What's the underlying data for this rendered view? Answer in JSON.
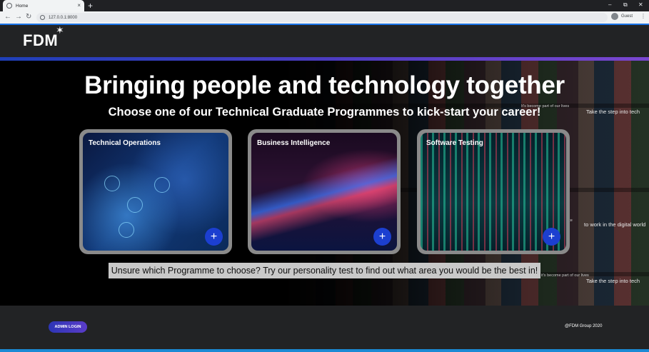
{
  "browser": {
    "tab_title": "Home",
    "tab_close": "×",
    "new_tab": "+",
    "url": "127.0.0.1:8000",
    "profile_label": "Guest",
    "icons": [
      "globe-icon",
      "close-icon",
      "back-icon",
      "forward-icon",
      "reload-icon",
      "info-icon",
      "avatar-icon",
      "kebab-menu-icon",
      "minimize-icon",
      "restore-icon",
      "window-close-icon"
    ]
  },
  "header": {
    "logo_text": "FDM"
  },
  "hero": {
    "title": "Bringing people and technology together",
    "subtitle": "Choose one of our Technical Graduate Programmes to kick-start your career!",
    "mosaic_captions": [
      "It's become part of our lives",
      "Take the step into tech",
      "to work in the digital world",
      "Take the step into tech",
      "ce",
      "it's become part of our lives"
    ],
    "cards": [
      {
        "title": "Technical Operations",
        "button": "+"
      },
      {
        "title": "Business Intelligence",
        "button": "+"
      },
      {
        "title": "Software Testing",
        "button": "+"
      }
    ],
    "test_banner": "Unsure which Programme to choose? Try our personality test to find out what area you would be the best in!"
  },
  "footer": {
    "admin_button": "ADMIN LOGIN",
    "copyright": "@FDM Group 2020"
  },
  "colors": {
    "accent_blue": "#1c3fd0",
    "gradient_start": "#1f3fb8",
    "gradient_end": "#7a46d0",
    "footer_bg": "#222325",
    "chrome_accent": "#1a73e8"
  }
}
